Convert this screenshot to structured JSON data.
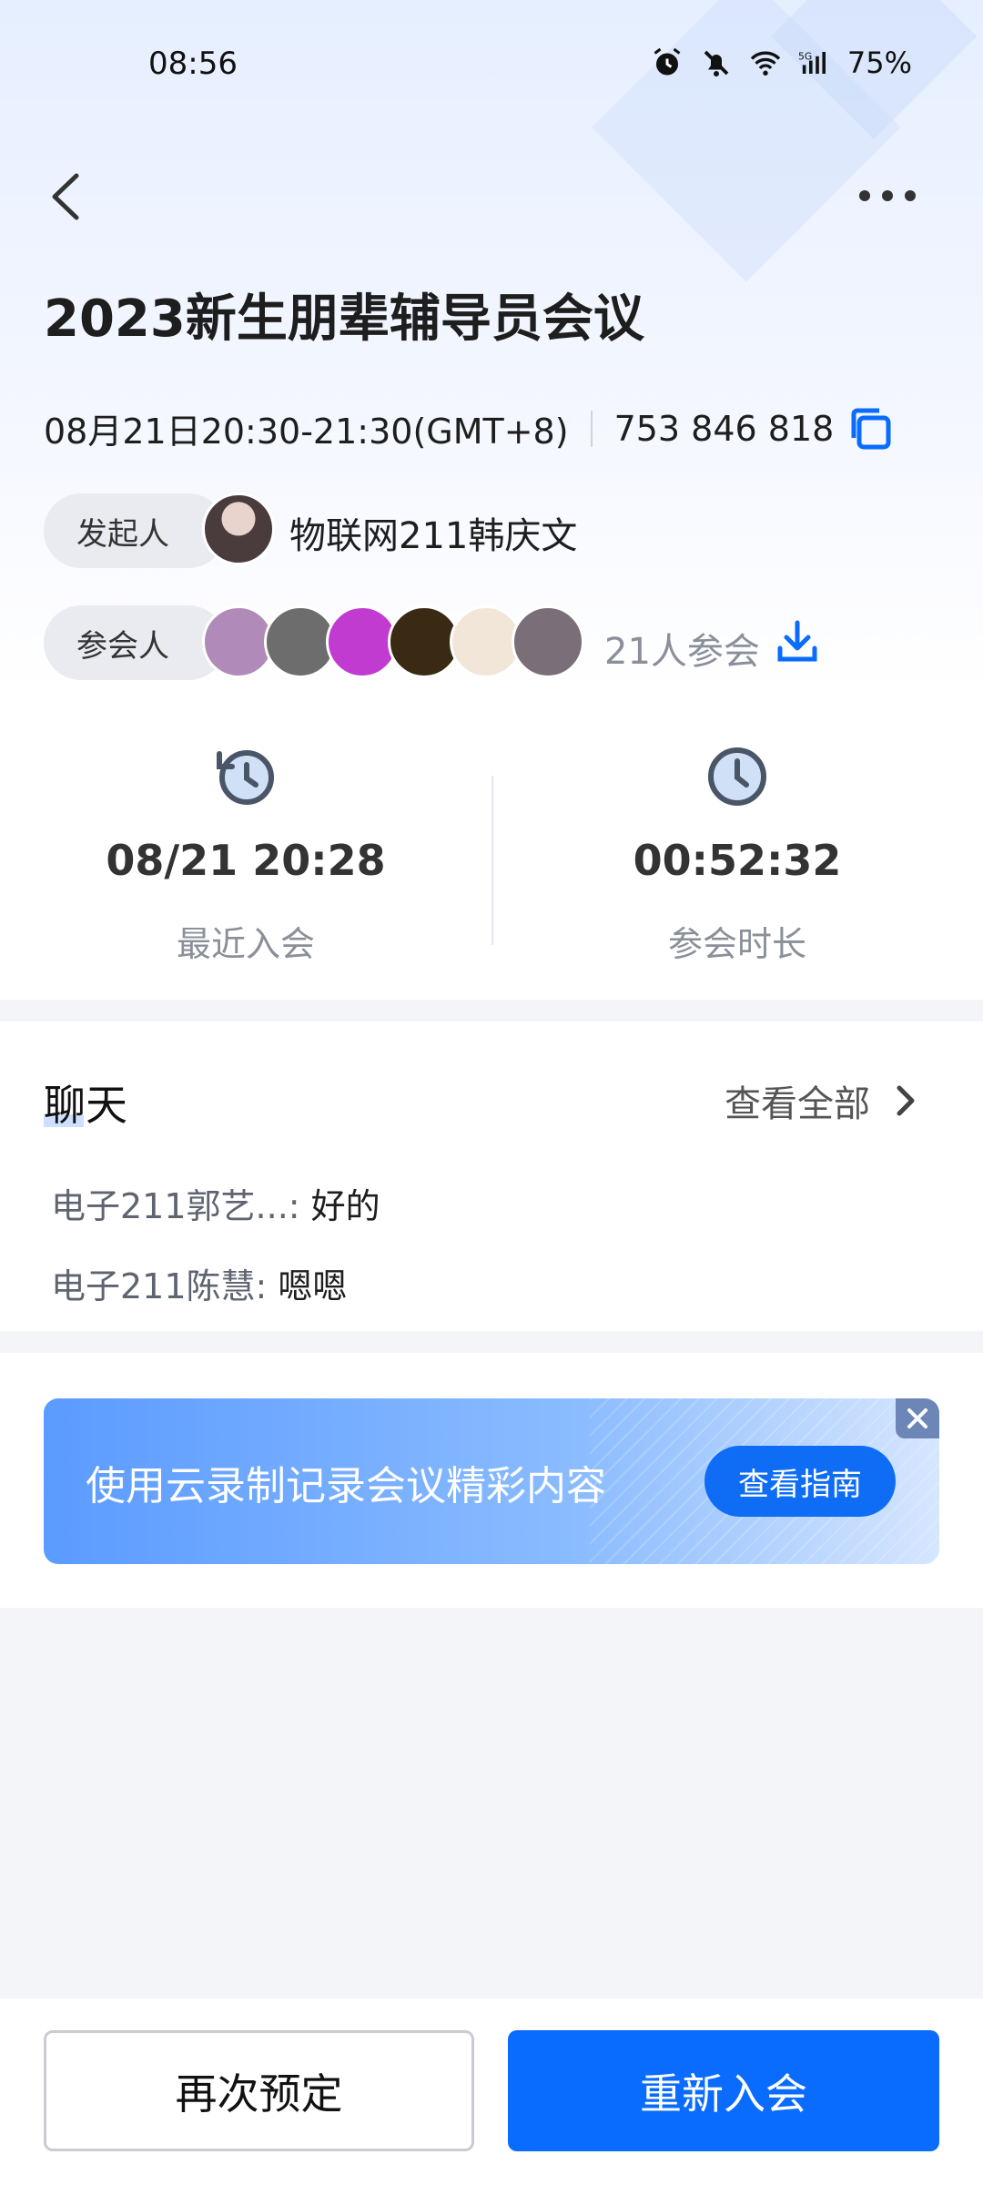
{
  "status_bar": {
    "time": "08:56",
    "battery": "75%"
  },
  "header": {
    "title": "2023新生朋辈辅导员会议"
  },
  "meeting": {
    "time": "08月21日20:30-21:30(GMT+8)",
    "meeting_id": "753 846 818"
  },
  "host": {
    "label": "发起人",
    "name": "物联网211韩庆文"
  },
  "attendees": {
    "label": "参会人",
    "count_text": "21人参会",
    "avatar_colors": [
      "#b08ab8",
      "#6d6d6d",
      "#c23bd1",
      "#3a2a14",
      "#f2e6d8",
      "#7a6e78"
    ]
  },
  "stats": {
    "last_join_value": "08/21 20:28",
    "last_join_label": "最近入会",
    "duration_value": "00:52:32",
    "duration_label": "参会时长"
  },
  "chat": {
    "title": "聊天",
    "view_all": "查看全部",
    "messages": [
      {
        "sender": "电子211郭艺...: ",
        "text": "好的"
      },
      {
        "sender": "电子211陈慧: ",
        "text": "嗯嗯"
      }
    ]
  },
  "banner": {
    "text": "使用云录制记录会议精彩内容",
    "button": "查看指南"
  },
  "actions": {
    "rebook": "再次预定",
    "rejoin": "重新入会"
  },
  "colors": {
    "accent": "#0a6cff",
    "chip_bg": "#e9ebf0"
  }
}
